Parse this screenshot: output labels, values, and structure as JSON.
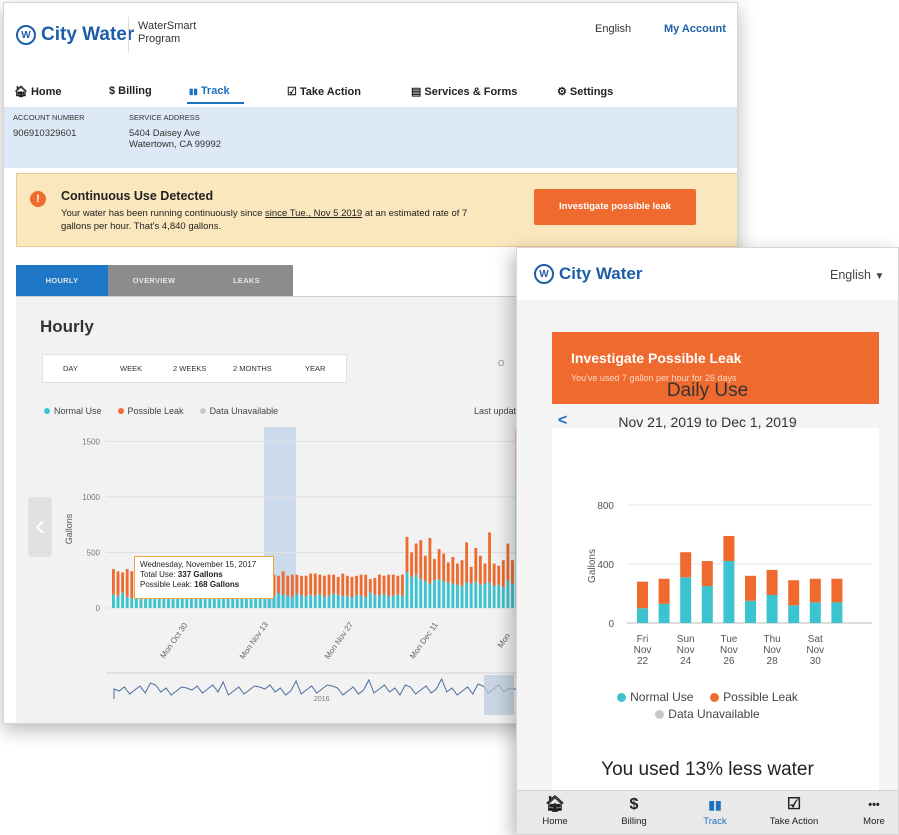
{
  "desktop": {
    "brand": "City Water",
    "program": "WaterSmart\nProgram",
    "language": "English",
    "my_account": "My Account",
    "nav": [
      {
        "label": "Home",
        "icon": "home-icon",
        "glyph": "🏠︎"
      },
      {
        "label": "Billing",
        "icon": "dollar-icon",
        "glyph": "$"
      },
      {
        "label": "Track",
        "icon": "bar-chart-icon",
        "glyph": "▮▮"
      },
      {
        "label": "Take Action",
        "icon": "checkbox-icon",
        "glyph": "☑"
      },
      {
        "label": "Services & Forms",
        "icon": "document-icon",
        "glyph": "▤"
      },
      {
        "label": "Settings",
        "icon": "gear-icon",
        "glyph": "⚙"
      }
    ],
    "active_nav": "Track",
    "account": {
      "number_label": "ACCOUNT NUMBER",
      "number": "906910329601",
      "address_label": "SERVICE ADDRESS",
      "address_line1": "5404 Daisey Ave",
      "address_line2": "Watertown, CA 99992"
    },
    "alert": {
      "title": "Continuous Use Detected",
      "body_prefix": "Your water has been running continuously since ",
      "body_date": "since Tue., Nov 5 2019",
      "body_suffix": " at an estimated rate of 7 gallons per hour. That's 4,840 gallons.",
      "button": "Investigate possible leak"
    },
    "tabs": [
      "HOURLY",
      "OVERVIEW",
      "LEAKS"
    ],
    "active_tab": "HOURLY",
    "chart_heading": "Hourly",
    "ranges": [
      "DAY",
      "WEEK",
      "2 WEEKS",
      "2 MONTHS",
      "YEAR"
    ],
    "right_chip": "O",
    "legend": [
      "Normal Use",
      "Possible Leak",
      "Data Unavailable"
    ],
    "last_updated": "Last update",
    "tooltip": {
      "date": "Wednesday, November 15, 2017",
      "total_label": "Total Use: ",
      "total_value": "337 Gallons",
      "leak_label": "Possible Leak: ",
      "leak_value": "168 Gallons"
    },
    "overview_year_label": "2016",
    "colors": {
      "normal": "#3cc3d0",
      "leak": "#ef6a2f",
      "unavailable": "#c9c9c9",
      "brand": "#1d5ea8",
      "alert_bg": "#fbe7bd"
    }
  },
  "mobile": {
    "brand": "City Water",
    "language": "English",
    "cta_title": "Investigate Possible Leak",
    "cta_subtitle": "You've used 7 gallon per hour for 26 days",
    "chart_title": "Daily Use",
    "date_range": "Nov 21, 2019 to Dec 1, 2019",
    "legend": [
      "Normal Use",
      "Possible Leak",
      "Data Unavailable"
    ],
    "summary": "You used 13% less water",
    "tabbar": [
      {
        "label": "Home",
        "icon": "home-icon",
        "glyph": "🏠︎"
      },
      {
        "label": "Billing",
        "icon": "dollar-icon",
        "glyph": "$"
      },
      {
        "label": "Track",
        "icon": "bar-chart-icon",
        "glyph": "▮▮"
      },
      {
        "label": "Take Action",
        "icon": "checkbox-icon",
        "glyph": "☑"
      },
      {
        "label": "More",
        "icon": "more-icon",
        "glyph": "•••"
      }
    ],
    "active_tab": "Track"
  },
  "chart_data": [
    {
      "type": "bar",
      "stacked": true,
      "title": "Hourly",
      "ylabel": "Gallons",
      "ylim": [
        0,
        1800
      ],
      "yticks": [
        0,
        500,
        1000,
        1500
      ],
      "xtick_labels": [
        "Mon Oct 30",
        "Mon Nov 13",
        "Mon Nov 27",
        "Mon Dec 11",
        "Mon"
      ],
      "series": [
        {
          "name": "Normal Use",
          "values": [
            120,
            110,
            140,
            100,
            90,
            130,
            110,
            95,
            120,
            105,
            115,
            100,
            130,
            120,
            110,
            90,
            110,
            125,
            105,
            115,
            100,
            110,
            120,
            130,
            140,
            95,
            110,
            120,
            100,
            115,
            160,
            150,
            140,
            130,
            120,
            110,
            135,
            120,
            110,
            100,
            130,
            115,
            105,
            120,
            110,
            125,
            100,
            115,
            130,
            120,
            105,
            110,
            95,
            120,
            110,
            100,
            140,
            120,
            110,
            130,
            105,
            115,
            120,
            110,
            320,
            280,
            300,
            260,
            240,
            220,
            250,
            260,
            240,
            230,
            220,
            210,
            200,
            230,
            220,
            240,
            210,
            220,
            230,
            200,
            210,
            190,
            250,
            220,
            1100,
            420,
            230,
            210
          ]
        },
        {
          "name": "Possible Leak",
          "values": [
            230,
            220,
            180,
            250,
            240,
            210,
            200,
            215,
            200,
            230,
            190,
            220,
            200,
            210,
            190,
            210,
            220,
            215,
            200,
            180,
            160,
            190,
            170,
            200,
            180,
            150,
            180,
            170,
            220,
            205,
            120,
            140,
            170,
            180,
            160,
            190,
            155,
            210,
            180,
            200,
            170,
            175,
            185,
            190,
            200,
            175,
            190,
            185,
            170,
            160,
            205,
            180,
            185,
            170,
            190,
            200,
            120,
            150,
            190,
            160,
            195,
            185,
            170,
            190,
            320,
            220,
            280,
            350,
            230,
            410,
            190,
            270,
            250,
            180,
            240,
            190,
            230,
            360,
            150,
            300,
            260,
            180,
            450,
            200,
            170,
            240,
            330,
            210,
            500,
            260,
            280,
            220
          ]
        }
      ]
    },
    {
      "type": "bar",
      "stacked": true,
      "title": "Daily Use",
      "ylabel": "Gallons",
      "ylim": [
        0,
        800
      ],
      "yticks": [
        0,
        400,
        800
      ],
      "categories": [
        "Fri Nov 22",
        "",
        "Sun Nov 24",
        "",
        "Tue Nov 26",
        "",
        "Thu Nov 28",
        "",
        "Sat Nov 30",
        ""
      ],
      "tick_labels": [
        [
          "Fri",
          "Nov",
          "22"
        ],
        [
          "Sun",
          "Nov",
          "24"
        ],
        [
          "Tue",
          "Nov",
          "26"
        ],
        [
          "Thu",
          "Nov",
          "28"
        ],
        [
          "Sat",
          "Nov",
          "30"
        ]
      ],
      "series": [
        {
          "name": "Normal Use",
          "values": [
            100,
            130,
            310,
            250,
            420,
            150,
            190,
            120,
            140,
            140
          ]
        },
        {
          "name": "Possible Leak",
          "values": [
            180,
            170,
            170,
            170,
            170,
            170,
            170,
            170,
            160,
            160
          ]
        }
      ]
    }
  ]
}
